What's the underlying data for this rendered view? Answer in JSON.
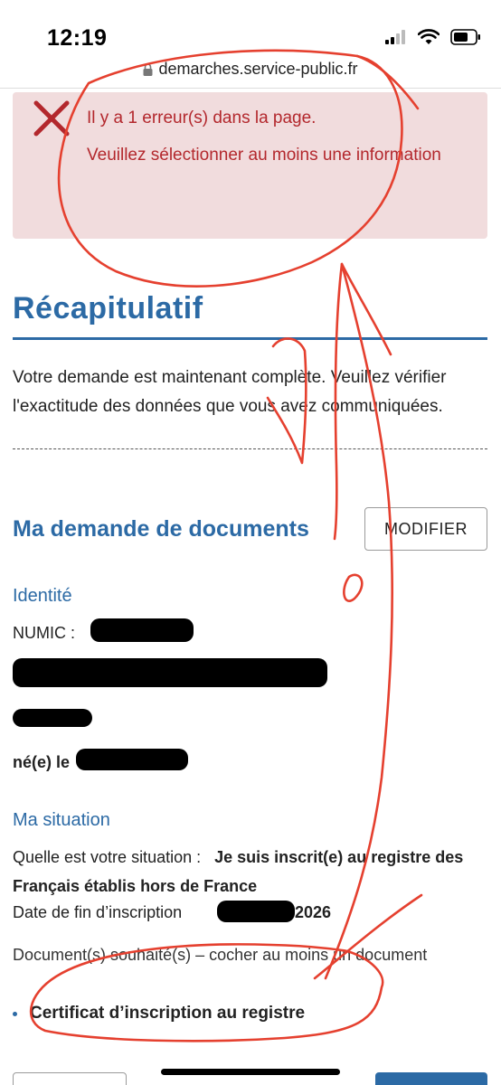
{
  "status_bar": {
    "time": "12:19"
  },
  "browser": {
    "url": "demarches.service-public.fr",
    "lock_icon": "lock-icon"
  },
  "error": {
    "icon": "error-x-icon",
    "title": "Il y a 1 erreur(s) dans la page.",
    "message": "Veuillez sélectionner au moins une information"
  },
  "recap": {
    "title": "Récapitulatif",
    "text": "Votre demande est maintenant complète. Veuillez vérifier l'exactitude des données que vous avez communiquées."
  },
  "documents": {
    "title": "Ma demande de documents",
    "modify_label": "MODIFIER",
    "identity": {
      "title": "Identité",
      "numic_label": "NUMIC :",
      "born_label": "né(e) le"
    },
    "situation": {
      "title": "Ma situation",
      "question_label": "Quelle est votre situation :",
      "answer": "Je suis inscrit(e) au registre des Français établis hors de France",
      "end_date_label": "Date de fin d’inscription",
      "end_date_year": "2026",
      "docs_label": "Document(s) souhaité(s) – cocher au moins un document",
      "selected_doc": "Certificat d’inscription au registre"
    }
  },
  "colors": {
    "primary": "#2c6aa5",
    "error": "#b3282d",
    "error_bg": "#f1dcdd",
    "annotation": "#e5402f"
  }
}
